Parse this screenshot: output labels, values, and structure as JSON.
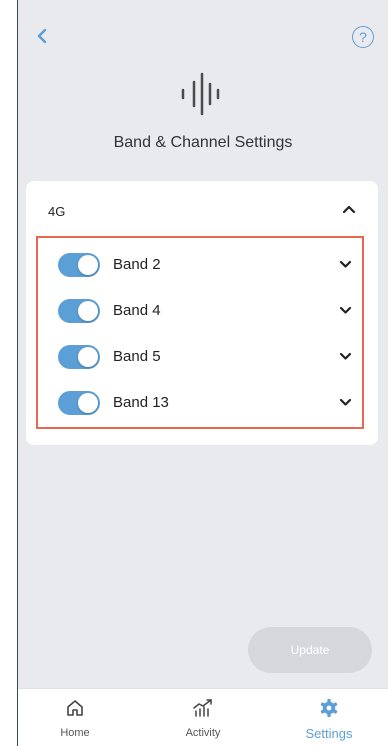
{
  "header": {
    "help_glyph": "?",
    "title": "Band & Channel Settings"
  },
  "section": {
    "label": "4G",
    "expanded": true
  },
  "bands": [
    {
      "label": "Band 2",
      "enabled": true
    },
    {
      "label": "Band 4",
      "enabled": true
    },
    {
      "label": "Band 5",
      "enabled": true
    },
    {
      "label": "Band 13",
      "enabled": true
    }
  ],
  "update_button": {
    "label": "Update",
    "enabled": false
  },
  "nav": {
    "home": "Home",
    "activity": "Activity",
    "settings": "Settings",
    "active": "settings"
  },
  "colors": {
    "accent": "#5b9fd6",
    "highlight_border": "#e8674f",
    "background": "#e9eaee",
    "disabled_button": "#d6d7db"
  },
  "icons": {
    "back": "chevron-left-icon",
    "help": "question-circle-icon",
    "hero": "sound-wave-icon",
    "home": "home-icon",
    "activity": "activity-chart-icon",
    "settings": "gear-icon"
  }
}
